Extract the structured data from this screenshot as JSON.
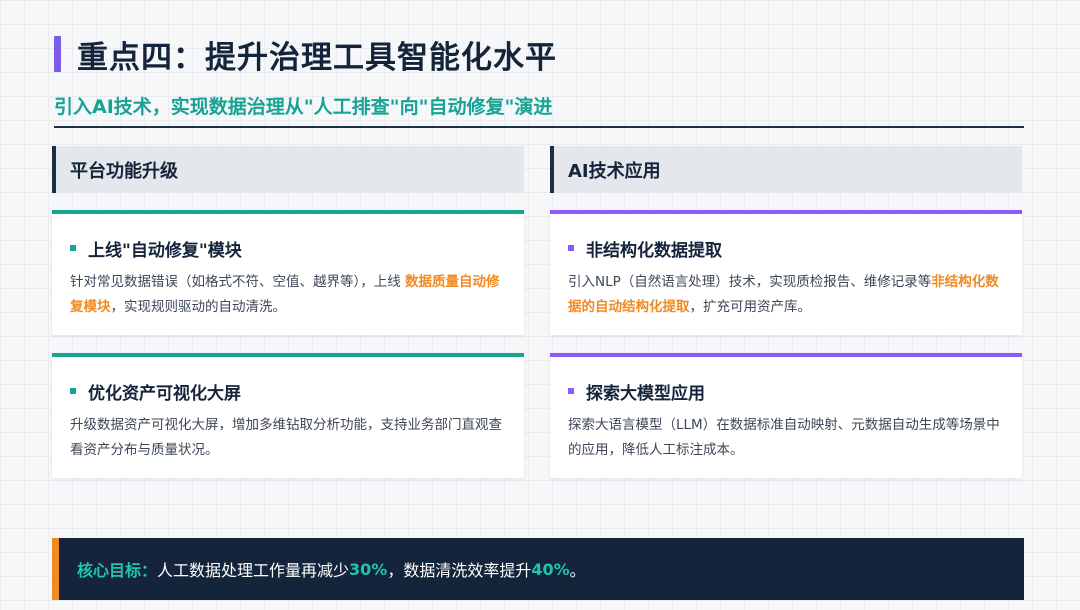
{
  "header": {
    "title": "重点四：提升治理工具智能化水平",
    "subtitle": "引入AI技术，实现数据治理从\"人工排查\"向\"自动修复\"演进"
  },
  "columns": [
    {
      "header": "平台功能升级",
      "cards": [
        {
          "title": "上线\"自动修复\"模块",
          "body_before": "针对常见数据错误（如格式不符、空值、越界等），上线 ",
          "body_highlight": "数据质量自动修复模块",
          "body_after": "，实现规则驱动的自动清洗。"
        },
        {
          "title": "优化资产可视化大屏",
          "body_before": "升级数据资产可视化大屏，增加多维钻取分析功能，支持业务部门直观查看资产分布与质量状况。",
          "body_highlight": "",
          "body_after": ""
        }
      ]
    },
    {
      "header": "AI技术应用",
      "cards": [
        {
          "title": "非结构化数据提取",
          "body_before": "引入NLP（自然语言处理）技术，实现质检报告、维修记录等",
          "body_highlight": "非结构化数据的自动结构化提取",
          "body_after": "，扩充可用资产库。"
        },
        {
          "title": "探索大模型应用",
          "body_before": "探索大语言模型（LLM）在数据标准自动映射、元数据自动生成等场景中的应用，降低人工标注成本。",
          "body_highlight": "",
          "body_after": ""
        }
      ]
    }
  ],
  "goal": {
    "label": "核心目标：",
    "text1": "人工数据处理工作量再减少 ",
    "value1": "30%",
    "text2": "，数据清洗效率提升 ",
    "value2": "40%",
    "text3": "。"
  },
  "colors": {
    "accent_teal": "#17a394",
    "accent_purple": "#8b5cf6",
    "highlight_orange": "#f08a24",
    "navy": "#14243a"
  }
}
